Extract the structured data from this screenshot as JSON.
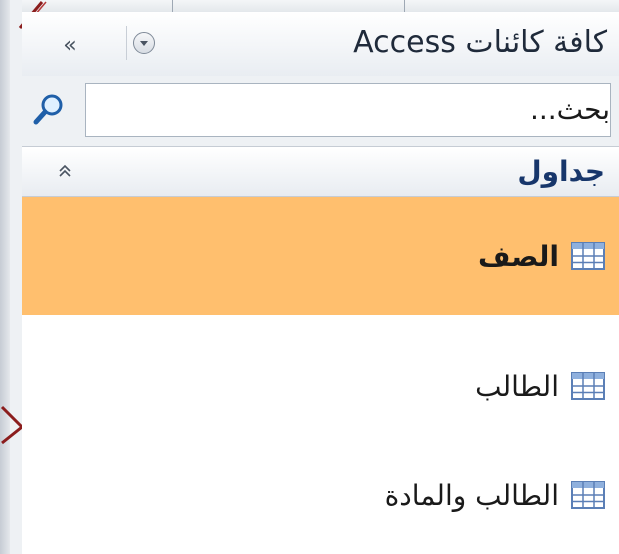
{
  "nav_pane": {
    "title": "كافة كائنات Access",
    "dropdown_icon": "chevron-down-circle-icon",
    "shutter_label": "»",
    "shutter_icon": "double-chevron-icon",
    "search": {
      "placeholder": "بحث...",
      "value": "",
      "icon": "magnifier-icon"
    },
    "groups": [
      {
        "title": "جداول",
        "collapse_icon": "double-chevron-up-icon",
        "items": [
          {
            "label": "الصف",
            "icon": "table-icon",
            "selected": true
          },
          {
            "label": "الطالب",
            "icon": "table-icon",
            "selected": false
          },
          {
            "label": "الطالب والمادة",
            "icon": "table-icon",
            "selected": false
          }
        ]
      }
    ]
  },
  "colors": {
    "selected_background": "#ffbf6e",
    "group_title": "#17366b",
    "pane_background": "#ffffff"
  }
}
